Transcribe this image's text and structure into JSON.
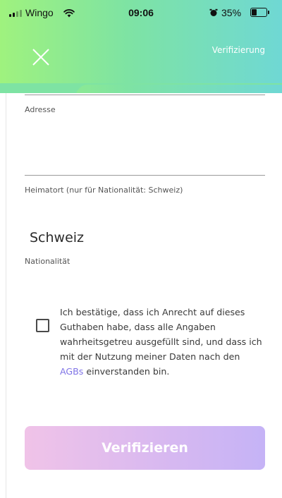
{
  "status_bar": {
    "carrier": "Wingo",
    "time": "09:06",
    "battery_percent": "35%",
    "battery_level": 0.35,
    "icons": [
      "signal-icon",
      "wifi-icon",
      "alarm-icon",
      "battery-icon"
    ]
  },
  "header": {
    "link_label": "Verifizierung",
    "close_icon": "close-icon",
    "gradient": [
      "#9ff27e",
      "#7ee3a3",
      "#6fd8d4"
    ]
  },
  "form": {
    "address_label": "Adresse",
    "hometown_label": "Heimatort (nur für Nationalität: Schweiz)",
    "nationality_value": "Schweiz",
    "nationality_label": "Nationalität"
  },
  "consent": {
    "text_before": "Ich bestätige, dass ich Anrecht auf dieses Guthaben habe, dass alle Angaben wahrheitsgetreu ausgefüllt sind, und dass ich mit der Nutzung meiner Daten nach den ",
    "link": "AGBs",
    "text_after": " einverstanden bin.",
    "checked": false
  },
  "submit": {
    "label": "Verifizieren",
    "colors": [
      "#f0c3e8",
      "#d9b9f0",
      "#c5b3f6"
    ]
  },
  "colors": {
    "link": "#7f73e6"
  }
}
